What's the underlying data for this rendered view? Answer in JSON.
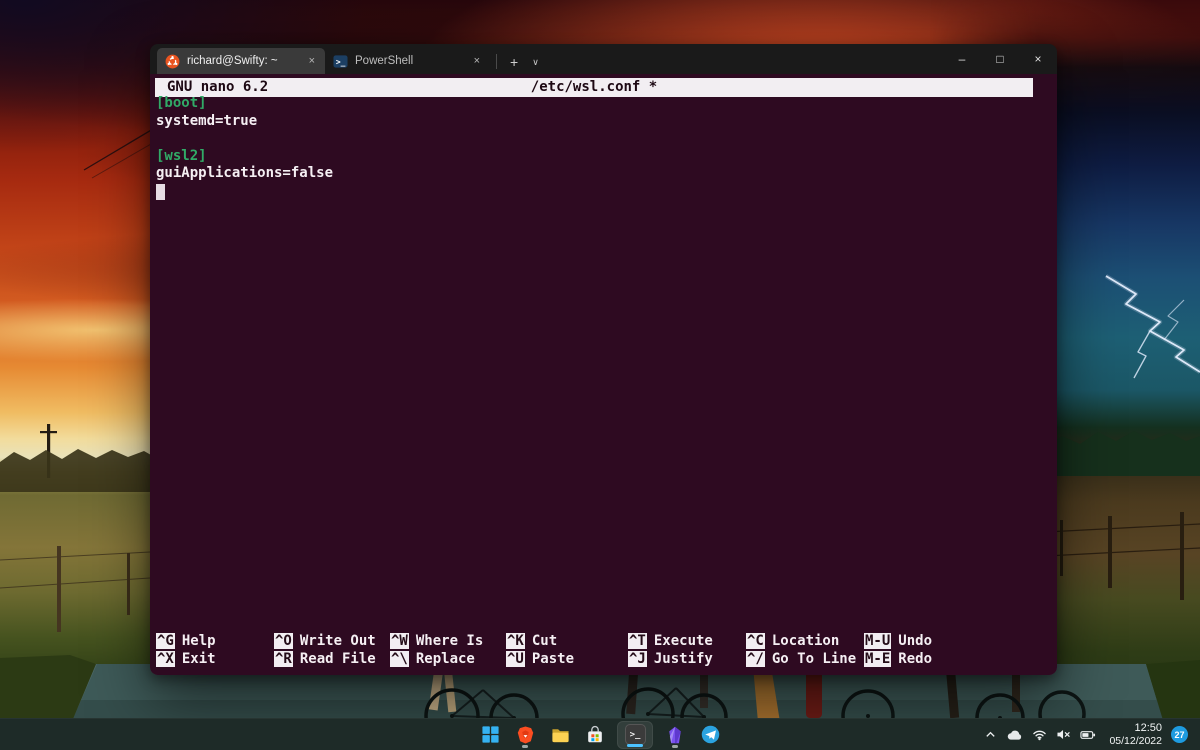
{
  "colors": {
    "terminal-bg": "#2e0a21",
    "terminal-fg": "#f5eff3",
    "titlebar-bg": "#1a1a1a",
    "tab-active-bg": "#3a3a3a",
    "nano-bar-bg": "#f2eef2",
    "nano-bar-fg": "#1d0813",
    "nano-green": "#31aa67",
    "taskbar-bg": "#1e2b28",
    "accent-blue": "#4cc2ff",
    "badge-bg": "#1e9be0"
  },
  "window": {
    "title_tabs": [
      {
        "label": "richard@Swifty: ~",
        "icon": "ubuntu-icon",
        "active": true,
        "close_glyph": "×"
      },
      {
        "label": "PowerShell",
        "icon": "powershell-icon",
        "active": false,
        "close_glyph": "×"
      }
    ],
    "new_tab_glyph": "+",
    "dropdown_glyph": "∨",
    "controls": {
      "minimize_glyph": "–",
      "maximize_glyph": "□",
      "close_glyph": "×"
    }
  },
  "nano": {
    "version": "GNU nano 6.2",
    "filename": "/etc/wsl.conf *",
    "buffer": [
      {
        "text": "[boot]",
        "section": true
      },
      {
        "text": "systemd=true",
        "section": false
      },
      {
        "text": "",
        "section": false
      },
      {
        "text": "[wsl2]",
        "section": true
      },
      {
        "text": "guiApplications=false",
        "section": false
      }
    ],
    "shortcuts_row1": [
      {
        "key": "^G",
        "label": "Help"
      },
      {
        "key": "^O",
        "label": "Write Out"
      },
      {
        "key": "^W",
        "label": "Where Is"
      },
      {
        "key": "^K",
        "label": "Cut"
      },
      {
        "key": "^T",
        "label": "Execute"
      },
      {
        "key": "^C",
        "label": "Location"
      },
      {
        "key": "M-U",
        "label": "Undo"
      }
    ],
    "shortcuts_row2": [
      {
        "key": "^X",
        "label": "Exit"
      },
      {
        "key": "^R",
        "label": "Read File"
      },
      {
        "key": "^\\",
        "label": "Replace"
      },
      {
        "key": "^U",
        "label": "Paste"
      },
      {
        "key": "^J",
        "label": "Justify"
      },
      {
        "key": "^/",
        "label": "Go To Line"
      },
      {
        "key": "M-E",
        "label": "Redo"
      }
    ]
  },
  "taskbar": {
    "apps": [
      {
        "name": "start"
      },
      {
        "name": "brave-browser",
        "running": true
      },
      {
        "name": "file-explorer"
      },
      {
        "name": "microsoft-store"
      },
      {
        "name": "windows-terminal",
        "running": true,
        "active": true,
        "glyph": ">_"
      },
      {
        "name": "obsidian",
        "running": true
      },
      {
        "name": "telegram"
      }
    ],
    "tray": {
      "icons": [
        "hidden-icons-chevron",
        "onedrive-cloud",
        "wifi",
        "volume-muted",
        "battery"
      ],
      "time": "12:50",
      "date": "05/12/2022",
      "notification_count": "27"
    }
  }
}
